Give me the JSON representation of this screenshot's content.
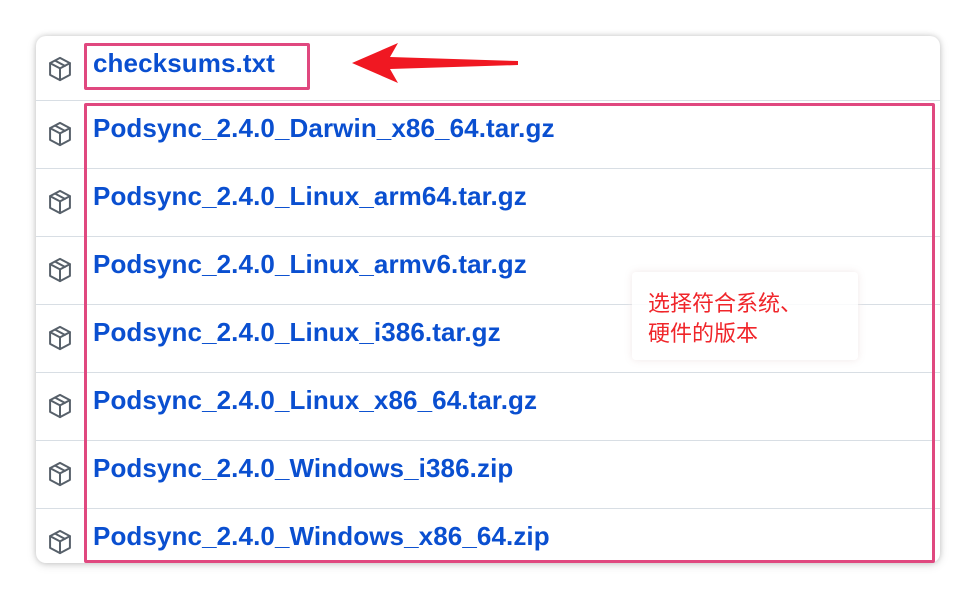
{
  "assets": [
    {
      "name": "checksums.txt"
    },
    {
      "name": "Podsync_2.4.0_Darwin_x86_64.tar.gz"
    },
    {
      "name": "Podsync_2.4.0_Linux_arm64.tar.gz"
    },
    {
      "name": "Podsync_2.4.0_Linux_armv6.tar.gz"
    },
    {
      "name": "Podsync_2.4.0_Linux_i386.tar.gz"
    },
    {
      "name": "Podsync_2.4.0_Linux_x86_64.tar.gz"
    },
    {
      "name": "Podsync_2.4.0_Windows_i386.zip"
    },
    {
      "name": "Podsync_2.4.0_Windows_x86_64.zip"
    }
  ],
  "annotation": {
    "line1": "选择符合系统、",
    "line2": "硬件的版本"
  },
  "icons": {
    "asset": "package-icon",
    "pointer": "red-arrow"
  },
  "colors": {
    "link": "#0a4fd0",
    "highlight_box": "#e0487f",
    "arrow": "#f01822",
    "annotation_text": "#f0252a"
  }
}
